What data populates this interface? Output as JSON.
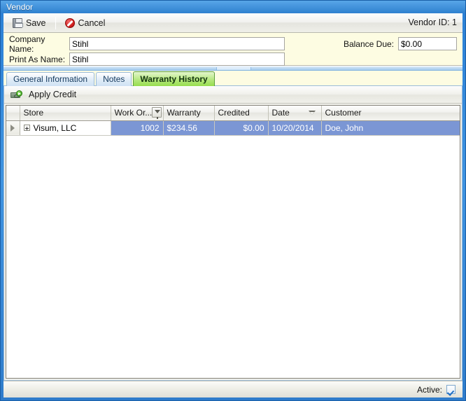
{
  "window": {
    "title": "Vendor"
  },
  "toolbar": {
    "save_label": "Save",
    "cancel_label": "Cancel",
    "vendor_id_label": "Vendor ID: 1",
    "save_icon": "floppy-disk-save-icon",
    "cancel_icon": "red-circle-slash-icon"
  },
  "fields": {
    "company_name_label": "Company Name:",
    "company_name_value": "Stihl",
    "print_as_name_label": "Print As Name:",
    "print_as_name_value": "Stihl",
    "balance_due_label": "Balance Due:",
    "balance_due_value": "$0.00"
  },
  "tabs": [
    {
      "label": "General Information",
      "active": false
    },
    {
      "label": "Notes",
      "active": false
    },
    {
      "label": "Warranty History",
      "active": true
    }
  ],
  "grid_toolbar": {
    "apply_credit_label": "Apply Credit",
    "apply_credit_icon": "money-with-green-arrow-icon"
  },
  "grid": {
    "columns": [
      {
        "key": "indicator",
        "label": ""
      },
      {
        "key": "store",
        "label": "Store"
      },
      {
        "key": "work_order",
        "label": "Work Or...",
        "filter_icon": "filter-funnel-icon"
      },
      {
        "key": "warranty",
        "label": "Warranty"
      },
      {
        "key": "credited",
        "label": "Credited"
      },
      {
        "key": "date",
        "label": "Date",
        "sort": "descending"
      },
      {
        "key": "customer",
        "label": "Customer"
      }
    ],
    "rows": [
      {
        "selected": true,
        "indicator": "row-current-arrow",
        "store": "Visum, LLC",
        "work_order": "1002",
        "warranty": "$234.56",
        "credited": "$0.00",
        "date": "10/20/2014",
        "customer": "Doe, John"
      }
    ]
  },
  "statusbar": {
    "active_label": "Active:",
    "active_checked": true
  },
  "colors": {
    "title_bar_blue": "#2e80cf",
    "selection_blue": "#7b96d4",
    "active_tab_green": "#96dd4e",
    "field_panel_yellow": "#fdfce2"
  }
}
